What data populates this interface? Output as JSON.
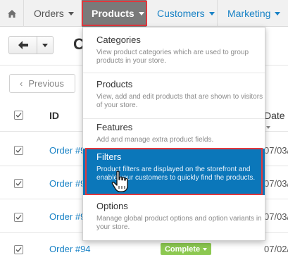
{
  "nav": {
    "orders": "Orders",
    "products": "Products",
    "customers": "Customers",
    "marketing": "Marketing"
  },
  "toolbar": {
    "title_fragment": "C",
    "previous_label": "Previous"
  },
  "table": {
    "headers": {
      "id": "ID",
      "date": "Date"
    },
    "rows": [
      {
        "order": "Order #9",
        "date": "07/03/"
      },
      {
        "order": "Order #9",
        "date": "07/03/"
      },
      {
        "order": "Order #9",
        "date": "07/03/"
      },
      {
        "order": "Order #94",
        "date": "07/02/",
        "status": "Complete"
      }
    ]
  },
  "dropdown": {
    "items": [
      {
        "title": "Categories",
        "desc": "View product categories which are used to group products in your store."
      },
      {
        "title": "Products",
        "desc": "View, add and edit products that are shown to visitors of your store."
      },
      {
        "title": "Features",
        "desc": "Add and manage extra product fields."
      },
      {
        "title": "Filters",
        "desc": "Product filters are displayed on the storefront and enable your customers to quickly find the products."
      },
      {
        "title": "Options",
        "desc": "Manage global product options and option variants in your store."
      }
    ]
  },
  "colors": {
    "link": "#1a83c6",
    "active_nav": "#7a7a7a",
    "highlight": "#0b77ba",
    "annotation": "#e0383e",
    "status_complete": "#8cc850"
  },
  "icons": [
    "home-icon",
    "arrow-left-icon",
    "chevron-left-icon",
    "checkbox-checked-icon",
    "hand-pointer-icon"
  ]
}
